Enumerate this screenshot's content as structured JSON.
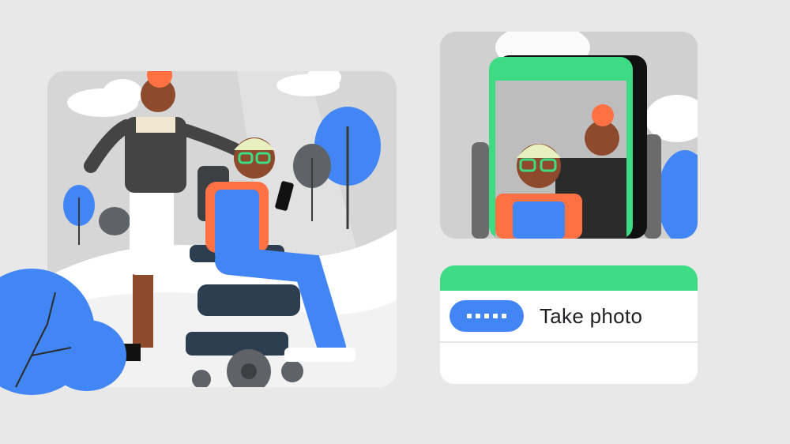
{
  "card": {
    "action_label": "Take photo",
    "button_icon": "password-dots-icon"
  },
  "colors": {
    "background": "#e8e8e8",
    "green": "#3ddc84",
    "blue": "#4285f4",
    "orange": "#ff7043"
  }
}
